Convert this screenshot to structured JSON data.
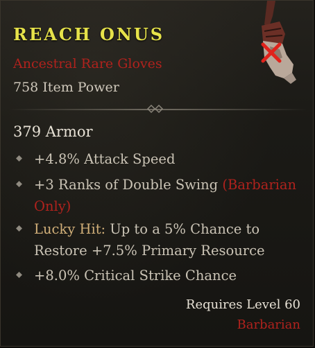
{
  "item": {
    "name": "REACH ONUS",
    "type": "Ancestral Rare Gloves",
    "item_power": "758 Item Power",
    "armor": "379 Armor",
    "affixes": [
      {
        "text": "+4.8% Attack Speed"
      },
      {
        "text": "+3 Ranks of Double Swing ",
        "suffix": "(Barbarian Only)"
      },
      {
        "prefix": "Lucky Hit:",
        "text": " Up to a 5% Chance to Restore +7.5% Primary Resource"
      },
      {
        "text": "+8.0% Critical Strike Chance"
      }
    ],
    "requires_level": "Requires Level 60",
    "required_class": "Barbarian"
  },
  "colors": {
    "name": "#e6e24a",
    "rare_red": "#b0221d",
    "lucky_hit_gold": "#d2b079",
    "body_text": "#cbc4b6"
  },
  "icons": {
    "item_image": "gloves-icon",
    "unusable_marker": "red-x-icon",
    "bullet": "diamond-bullet-icon",
    "divider": "divider-ornament-icon"
  }
}
